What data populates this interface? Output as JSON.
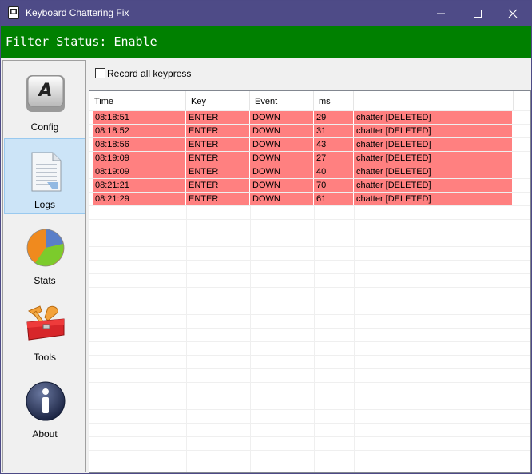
{
  "window": {
    "title": "Keyboard Chattering Fix"
  },
  "status": {
    "text": "Filter Status: Enable",
    "color": "#008000"
  },
  "sidebar": {
    "items": [
      {
        "label": "Config",
        "icon": "keyboard-key-icon"
      },
      {
        "label": "Logs",
        "icon": "document-icon"
      },
      {
        "label": "Stats",
        "icon": "pie-chart-icon"
      },
      {
        "label": "Tools",
        "icon": "toolbox-icon"
      },
      {
        "label": "About",
        "icon": "info-icon"
      }
    ],
    "active": "Logs"
  },
  "options": {
    "record_all_label": "Record all keypress",
    "record_all_checked": false
  },
  "log_table": {
    "columns": [
      "Time",
      "Key",
      "Event",
      "ms",
      ""
    ],
    "rows": [
      {
        "time": "08:18:51",
        "key": "ENTER",
        "event": "DOWN",
        "ms": "29",
        "note": "chatter [DELETED]"
      },
      {
        "time": "08:18:52",
        "key": "ENTER",
        "event": "DOWN",
        "ms": "31",
        "note": "chatter [DELETED]"
      },
      {
        "time": "08:18:56",
        "key": "ENTER",
        "event": "DOWN",
        "ms": "43",
        "note": "chatter [DELETED]"
      },
      {
        "time": "08:19:09",
        "key": "ENTER",
        "event": "DOWN",
        "ms": "27",
        "note": "chatter [DELETED]"
      },
      {
        "time": "08:19:09",
        "key": "ENTER",
        "event": "DOWN",
        "ms": "40",
        "note": "chatter [DELETED]"
      },
      {
        "time": "08:21:21",
        "key": "ENTER",
        "event": "DOWN",
        "ms": "70",
        "note": "chatter [DELETED]"
      },
      {
        "time": "08:21:29",
        "key": "ENTER",
        "event": "DOWN",
        "ms": "61",
        "note": "chatter [DELETED]"
      }
    ],
    "row_color": "#ff8080"
  }
}
